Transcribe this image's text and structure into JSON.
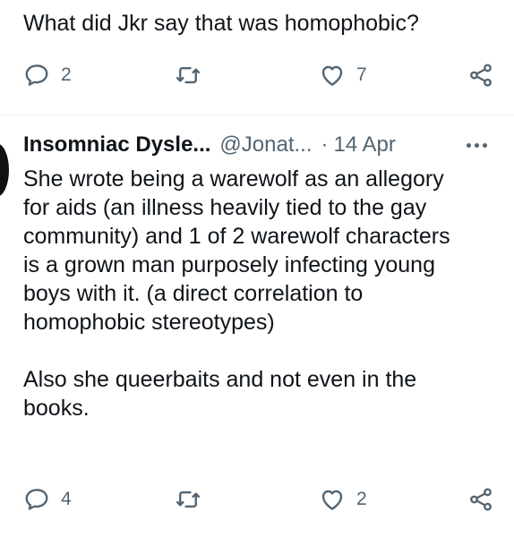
{
  "tweet1": {
    "text": "What did Jkr say that was homophobic?",
    "reply_count": "2",
    "like_count": "7"
  },
  "tweet2": {
    "author_name": "Insomniac Dysle...",
    "handle": "@Jonat...",
    "separator": "·",
    "date": "14 Apr",
    "text": "She wrote being a warewolf as an allegory\nfor aids (an illness heavily tied to the gay\ncommunity) and 1 of 2 warewolf characters\nis a grown man purposely infecting young\nboys with it. (a direct correlation to\nhomophobic stereotypes)\n\nAlso she queerbaits and not even in the\nbooks.",
    "reply_count": "4",
    "like_count": "2"
  },
  "icons": {
    "reply": "reply-icon",
    "retweet": "retweet-icon",
    "like": "like-icon",
    "share": "share-icon",
    "more": "more-icon"
  },
  "colors": {
    "text_primary": "#0f1419",
    "text_secondary": "#536471",
    "divider": "#eff3f4"
  }
}
